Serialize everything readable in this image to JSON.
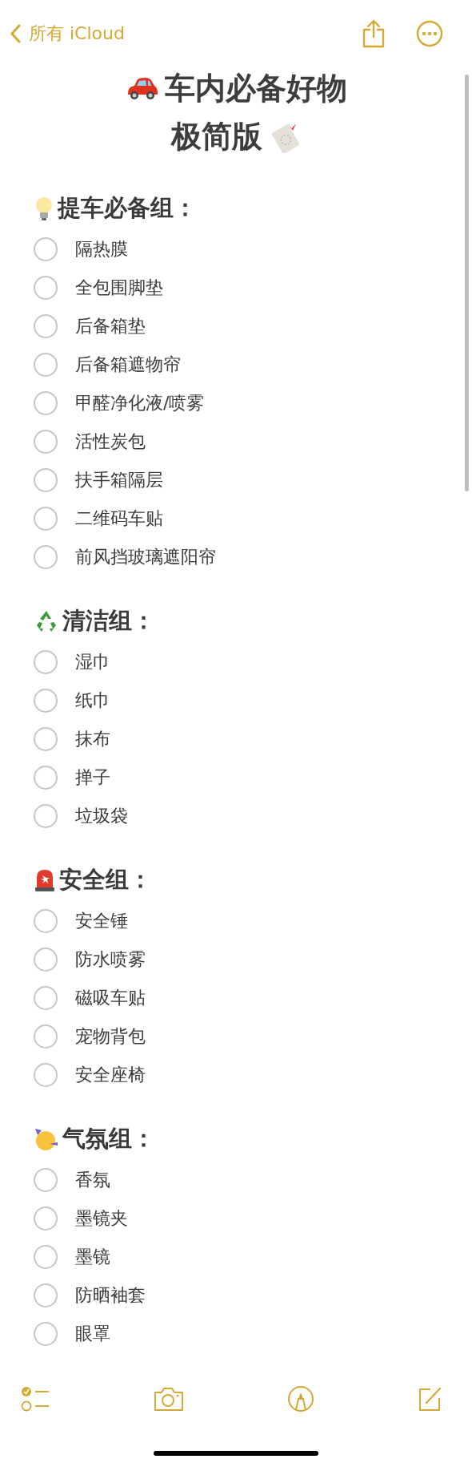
{
  "nav": {
    "back_label": "所有 iCloud"
  },
  "title": {
    "line_1": "车内必备好物",
    "line_2": "极简版"
  },
  "sections": [
    {
      "heading": "提车必备组：",
      "items": [
        {
          "text": "隔热膜",
          "checked": false
        },
        {
          "text": "全包围脚垫",
          "checked": false
        },
        {
          "text": "后备箱垫",
          "checked": false
        },
        {
          "text": "后备箱遮物帘",
          "checked": false
        },
        {
          "text": "甲醛净化液/喷雾",
          "checked": false
        },
        {
          "text": "活性炭包",
          "checked": false
        },
        {
          "text": "扶手箱隔层",
          "checked": false
        },
        {
          "text": "二维码车贴",
          "checked": false
        },
        {
          "text": "前风挡玻璃遮阳帘",
          "checked": false
        }
      ]
    },
    {
      "heading": "清洁组：",
      "items": [
        {
          "text": "湿巾",
          "checked": false
        },
        {
          "text": "纸巾",
          "checked": false
        },
        {
          "text": "抹布",
          "checked": false
        },
        {
          "text": "掸子",
          "checked": false
        },
        {
          "text": "垃圾袋",
          "checked": false
        }
      ]
    },
    {
      "heading": "安全组：",
      "items": [
        {
          "text": "安全锤",
          "checked": false
        },
        {
          "text": "防水喷雾",
          "checked": false
        },
        {
          "text": "磁吸车贴",
          "checked": false
        },
        {
          "text": "宠物背包",
          "checked": false
        },
        {
          "text": "安全座椅",
          "checked": false
        }
      ]
    },
    {
      "heading": "气氛组：",
      "items": [
        {
          "text": "香氛",
          "checked": false
        },
        {
          "text": "墨镜夹",
          "checked": false
        },
        {
          "text": "墨镜",
          "checked": false
        },
        {
          "text": "防晒袖套",
          "checked": false
        },
        {
          "text": "眼罩",
          "checked": false
        }
      ]
    }
  ]
}
